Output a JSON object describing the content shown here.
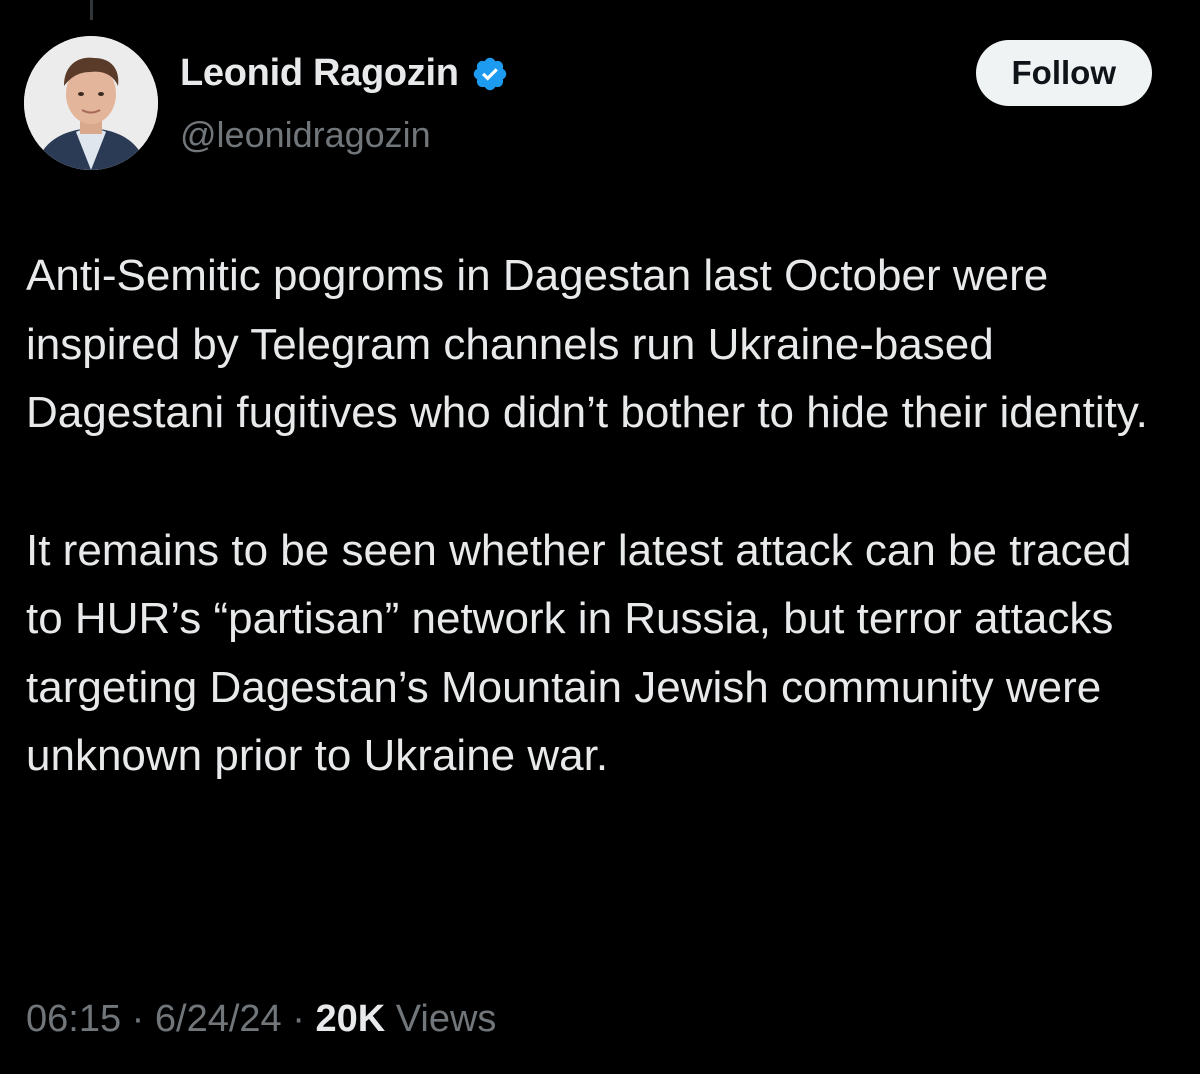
{
  "author": {
    "display_name": "Leonid Ragozin",
    "handle": "@leonidragozin",
    "verified": true,
    "verified_color": "#1d9bf0",
    "avatar_icon": "profile-photo"
  },
  "actions": {
    "follow_label": "Follow"
  },
  "tweet": {
    "paragraphs": [
      "Anti-Semitic pogroms in Dagestan last October were inspired by Telegram channels run Ukraine-based Dagestani fugitives who didn’t bother to hide their identity.",
      "It remains to be seen whether latest attack can be traced to HUR’s “partisan” network in Russia, but terror attacks targeting Dagestan’s Mountain Jewish community were unknown prior to Ukraine war."
    ]
  },
  "meta": {
    "time": "06:15",
    "separator": "·",
    "date": "6/24/24",
    "views_count": "20K",
    "views_label": "Views"
  },
  "colors": {
    "background": "#000000",
    "text_primary": "#e7e9ea",
    "text_secondary": "#71767b",
    "follow_bg": "#eff3f4"
  }
}
